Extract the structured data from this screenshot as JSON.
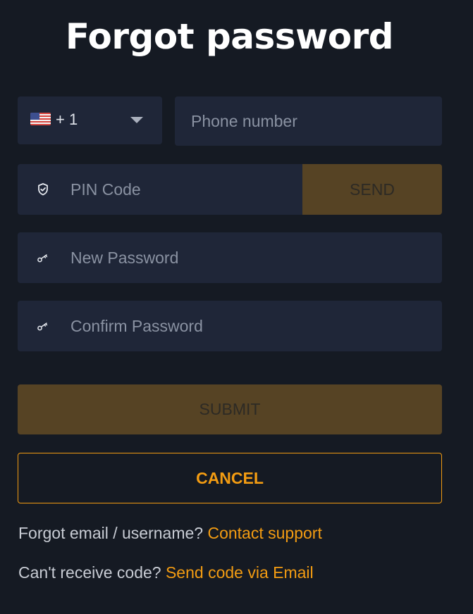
{
  "title": "Forgot password",
  "phone": {
    "country_flag": "us-flag-icon",
    "dial_code": "+ 1",
    "placeholder": "Phone number"
  },
  "pin": {
    "placeholder": "PIN Code",
    "send_label": "SEND"
  },
  "new_password": {
    "placeholder": "New Password"
  },
  "confirm_password": {
    "placeholder": "Confirm Password"
  },
  "submit_label": "SUBMIT",
  "cancel_label": "CANCEL",
  "help": {
    "forgot_email_text": "Forgot email / username?",
    "contact_support_link": "Contact support",
    "no_code_text": "Can't receive code?",
    "send_email_link": "Send code via Email"
  },
  "colors": {
    "background": "#151a23",
    "field": "#1f2638",
    "accent": "#f39c12",
    "disabled_button": "#564324"
  }
}
